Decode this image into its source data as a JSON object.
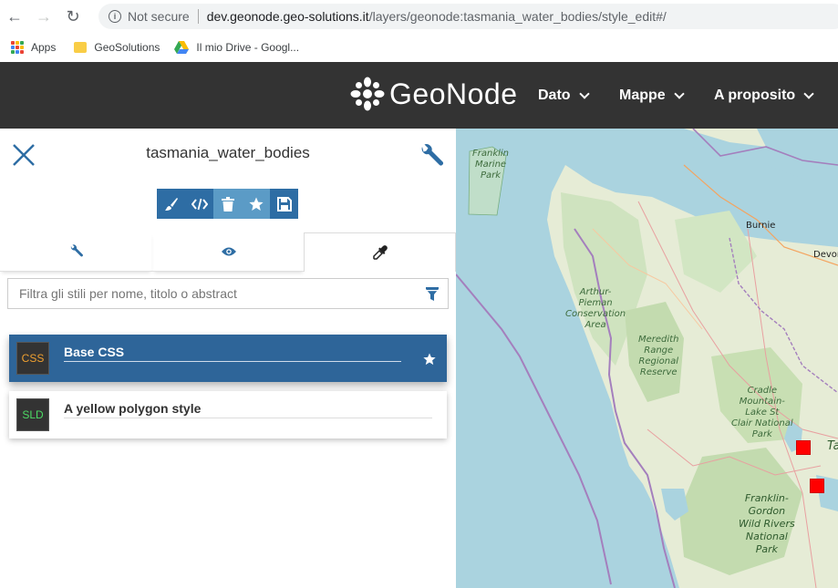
{
  "browser": {
    "nav": {
      "back": "←",
      "forward": "→",
      "reload": "↻"
    },
    "security": "Not secure",
    "url_host": "dev.geonode.geo-solutions.it",
    "url_path": "/layers/geonode:tasmania_water_bodies/style_edit#/",
    "bookmarks": [
      {
        "label": "Apps",
        "icon": "apps-grid-icon"
      },
      {
        "label": "GeoSolutions",
        "icon": "folder-icon"
      },
      {
        "label": "Il mio Drive - Googl...",
        "icon": "google-drive-icon"
      }
    ]
  },
  "header": {
    "logo_text": "GeoNode",
    "menu": [
      {
        "label": "Dato"
      },
      {
        "label": "Mappe"
      },
      {
        "label": "A proposito"
      }
    ],
    "colors": {
      "background": "#333333"
    }
  },
  "panel": {
    "title": "tasmania_water_bodies",
    "toolbar": [
      {
        "name": "edit-style-button",
        "icon": "✎"
      },
      {
        "name": "code-button",
        "icon": "</>"
      },
      {
        "name": "delete-button",
        "icon": "trash"
      },
      {
        "name": "set-default-button",
        "icon": "★"
      },
      {
        "name": "save-button",
        "icon": "floppy"
      }
    ],
    "tabs": [
      {
        "name": "tab-properties",
        "icon": "wrench-icon"
      },
      {
        "name": "tab-preview",
        "icon": "eye-icon"
      },
      {
        "name": "tab-styles",
        "icon": "eyedropper-icon",
        "active": true
      }
    ],
    "filter_placeholder": "Filtra gli stili per nome, titolo o abstract",
    "styles": [
      {
        "format": "CSS",
        "title": "Base CSS",
        "selected": true,
        "default": true
      },
      {
        "format": "SLD",
        "title": "A yellow polygon style",
        "selected": false,
        "default": false
      }
    ],
    "colors": {
      "accent": "#2e6da4",
      "selected_card": "#2e6599",
      "css_badge": "#f0a030",
      "sld_badge": "#4cd964"
    }
  },
  "map": {
    "labels": {
      "franklin_marine": [
        "Franklin",
        "Marine",
        "Park"
      ],
      "arthur_pieman": [
        "Arthur-",
        "Pieman",
        "Conservation",
        "Area"
      ],
      "meredith": [
        "Meredith",
        "Range",
        "Regional",
        "Reserve"
      ],
      "cradle": [
        "Cradle",
        "Mountain-",
        "Lake St",
        "Clair National",
        "Park"
      ],
      "franklin_gordon": [
        "Franklin-",
        "Gordon",
        "Wild Rivers",
        "National",
        "Park"
      ],
      "burnie": "Burnie",
      "devonport": "Devor",
      "ta": "Ta"
    }
  }
}
